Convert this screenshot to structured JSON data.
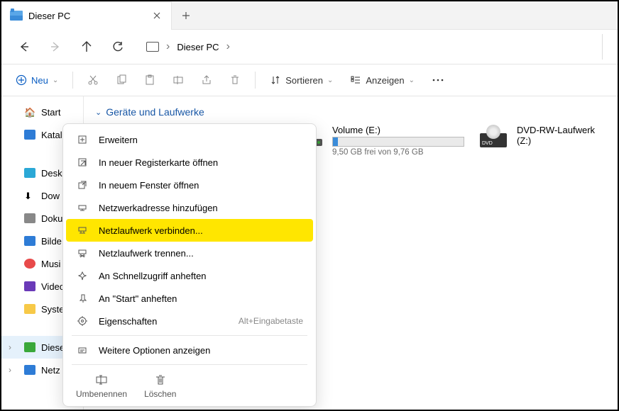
{
  "tab": {
    "title": "Dieser PC"
  },
  "breadcrumb": {
    "location": "Dieser PC"
  },
  "toolbar": {
    "new": "Neu",
    "sort": "Sortieren",
    "view": "Anzeigen"
  },
  "sidebar": {
    "items": [
      {
        "label": "Start"
      },
      {
        "label": "Katal"
      },
      {
        "label": "Desk"
      },
      {
        "label": "Dow"
      },
      {
        "label": "Doku"
      },
      {
        "label": "Bilde"
      },
      {
        "label": "Musi"
      },
      {
        "label": "Video"
      },
      {
        "label": "Syste"
      },
      {
        "label": "Diese"
      },
      {
        "label": "Netz"
      }
    ]
  },
  "section": {
    "title": "Geräte und Laufwerke"
  },
  "drives": [
    {
      "name": "Volume (E:)",
      "free_text": "9,50 GB frei von 9,76 GB",
      "fill_pct": 4
    },
    {
      "name": "DVD-RW-Laufwerk (Z:)"
    }
  ],
  "context_menu": {
    "items": [
      {
        "label": "Erweitern",
        "icon": "expand"
      },
      {
        "label": "In neuer Registerkarte öffnen",
        "icon": "newtab"
      },
      {
        "label": "In neuem Fenster öffnen",
        "icon": "newwin"
      },
      {
        "label": "Netzwerkadresse hinzufügen",
        "icon": "netadd"
      },
      {
        "label": "Netzlaufwerk verbinden...",
        "icon": "netmap",
        "highlight": true
      },
      {
        "label": "Netzlaufwerk trennen...",
        "icon": "netdisc"
      },
      {
        "label": "An Schnellzugriff anheften",
        "icon": "pin"
      },
      {
        "label": "An \"Start\" anheften",
        "icon": "pinstart"
      },
      {
        "label": "Eigenschaften",
        "icon": "props",
        "shortcut": "Alt+Eingabetaste"
      },
      {
        "label": "Weitere Optionen anzeigen",
        "icon": "more"
      }
    ],
    "bottom": [
      {
        "label": "Umbenennen",
        "icon": "rename"
      },
      {
        "label": "Löschen",
        "icon": "delete"
      }
    ]
  }
}
